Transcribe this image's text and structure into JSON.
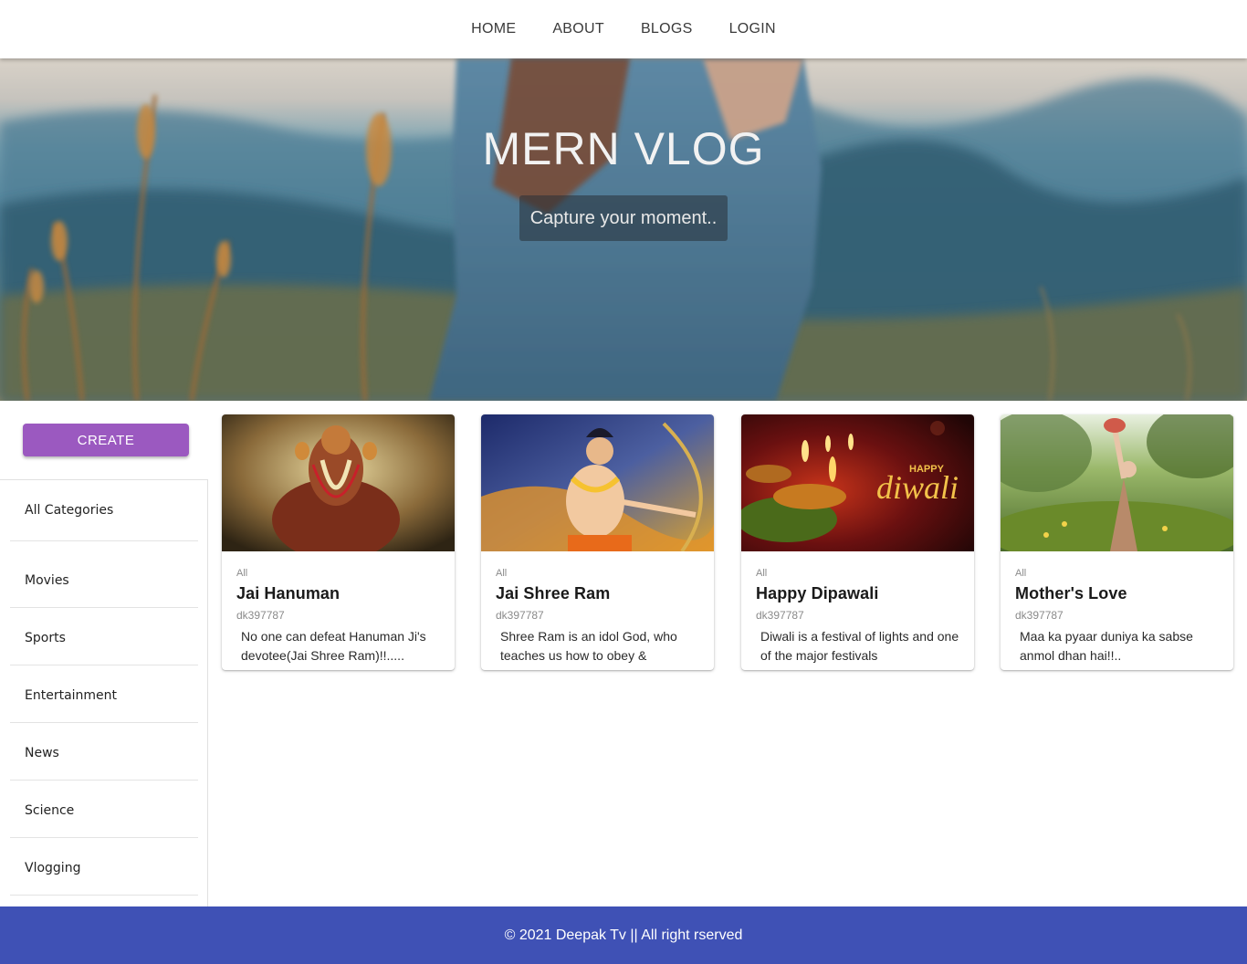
{
  "nav": {
    "items": [
      {
        "label": "HOME"
      },
      {
        "label": "ABOUT"
      },
      {
        "label": "BLOGS"
      },
      {
        "label": "LOGIN"
      }
    ]
  },
  "hero": {
    "title": "MERN VLOG",
    "subtitle": "Capture your moment.."
  },
  "sidebar": {
    "create_label": "CREATE",
    "categories": [
      {
        "label": "All Categories"
      },
      {
        "label": "Movies"
      },
      {
        "label": "Sports"
      },
      {
        "label": "Entertainment"
      },
      {
        "label": "News"
      },
      {
        "label": "Science"
      },
      {
        "label": "Vlogging"
      }
    ]
  },
  "posts": [
    {
      "category": "All",
      "title": "Jai Hanuman",
      "author": "dk397787",
      "description": "No one can defeat Hanuman Ji's devotee(Jai Shree Ram)!!....."
    },
    {
      "category": "All",
      "title": "Jai Shree Ram",
      "author": "dk397787",
      "description": "Shree Ram is an idol God, who teaches us how to obey &"
    },
    {
      "category": "All",
      "title": "Happy Dipawali",
      "author": "dk397787",
      "description": "Diwali is a festival of lights and one of the major festivals",
      "image_text": {
        "small": "HAPPY",
        "big": "diwali"
      }
    },
    {
      "category": "All",
      "title": "Mother's Love",
      "author": "dk397787",
      "description": "Maa ka pyaar duniya ka sabse anmol dhan hai!!.."
    }
  ],
  "footer": {
    "text": "© 2021 Deepak Tv || All right rserved"
  },
  "colors": {
    "create_button": "#9b59c0",
    "footer": "#3f51b5"
  }
}
